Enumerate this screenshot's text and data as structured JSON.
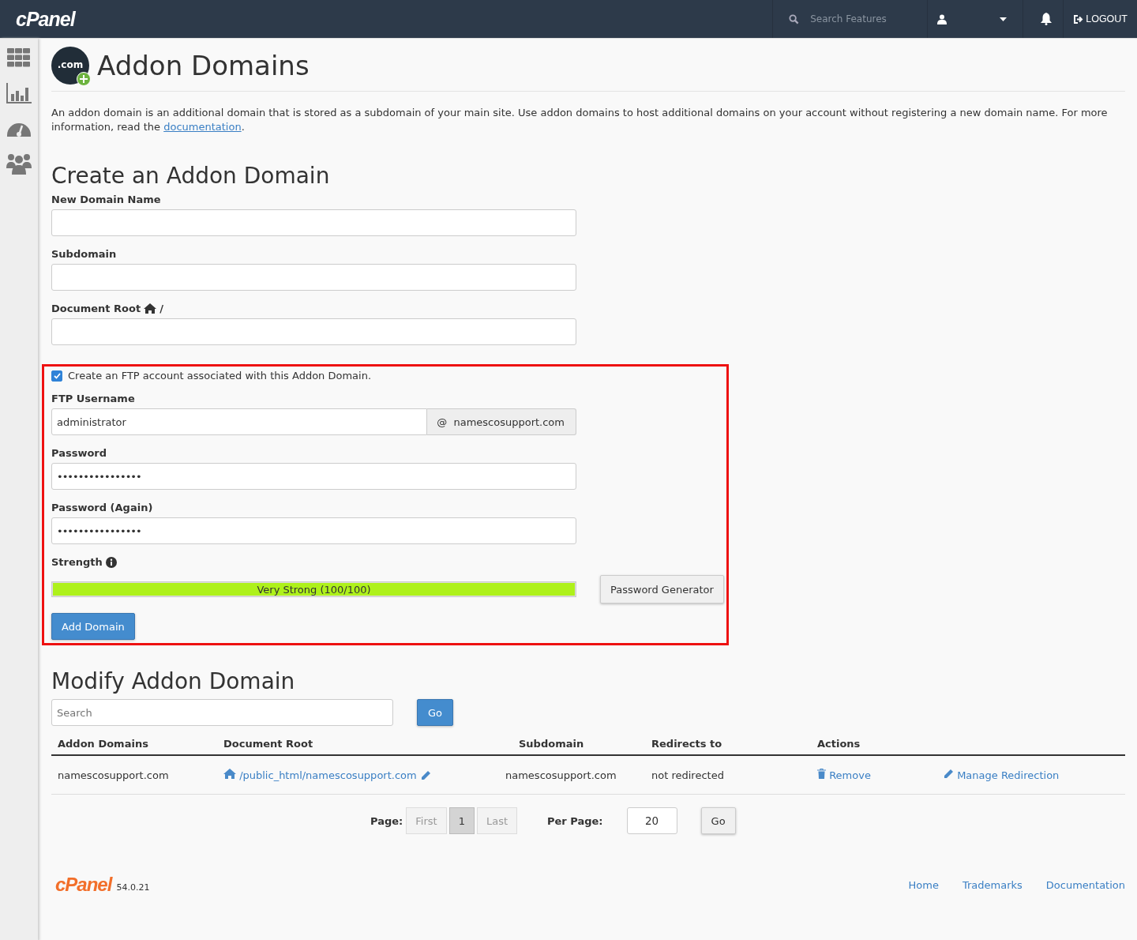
{
  "topbar": {
    "logo": "cPanel",
    "search": {
      "placeholder": "Search Features"
    },
    "logout": "LOGOUT"
  },
  "page": {
    "title": "Addon Domains",
    "badge": ".com",
    "intro_before": "An addon domain is an additional domain that is stored as a subdomain of your main site. Use addon domains to host additional domains on your account without registering a new domain name. For more information, read the ",
    "intro_link": "documentation",
    "intro_after": "."
  },
  "create": {
    "heading": "Create an Addon Domain",
    "fields": [
      {
        "label": "New Domain Name",
        "kind": "plain"
      },
      {
        "label": "Subdomain",
        "kind": "plain"
      },
      {
        "label": "Document Root",
        "kind": "docroot",
        "suffix": "/"
      }
    ]
  },
  "ftp": {
    "highlighted": true,
    "checkbox": {
      "label": "Create an FTP account associated with this Addon Domain.",
      "checked": true
    },
    "username": {
      "label": "FTP Username",
      "value": "administrator",
      "addon": "@  namescosupport.com"
    },
    "passwords": [
      {
        "label": "Password",
        "value": "••••••••••••••••"
      },
      {
        "label": "Password (Again)",
        "value": "••••••••••••••••"
      }
    ],
    "strength": {
      "label": "Strength",
      "level": 1,
      "reading": "Very Strong (100/100)"
    },
    "generator_button": "Password Generator",
    "submit_button": "Add Domain"
  },
  "modify": {
    "heading": "Modify Addon Domain",
    "search": {
      "placeholder": "Search"
    },
    "go": "Go",
    "table": {
      "columns": [
        "Addon Domains",
        "Document Root",
        "Subdomain",
        "Redirects to",
        "Actions"
      ],
      "rows": [
        {
          "domain": "namescosupport.com",
          "document_root": "/public_html/namescosupport.com",
          "subdomain": "namescosupport.com",
          "redirects_to": "not redirected",
          "actions": [
            "Remove",
            "Manage Redirection"
          ]
        }
      ]
    },
    "pagination": {
      "label": "Page:",
      "pages": [
        {
          "label": "First",
          "selected": false
        },
        {
          "label": "1",
          "selected": true
        },
        {
          "label": "Last",
          "selected": false
        }
      ],
      "per_page_label": "Per Page:",
      "per_page": "20",
      "go": "Go"
    }
  },
  "footer": {
    "logo": "cPanel",
    "version": "54.0.21",
    "links": [
      "Home",
      "Trademarks",
      "Documentation"
    ]
  }
}
